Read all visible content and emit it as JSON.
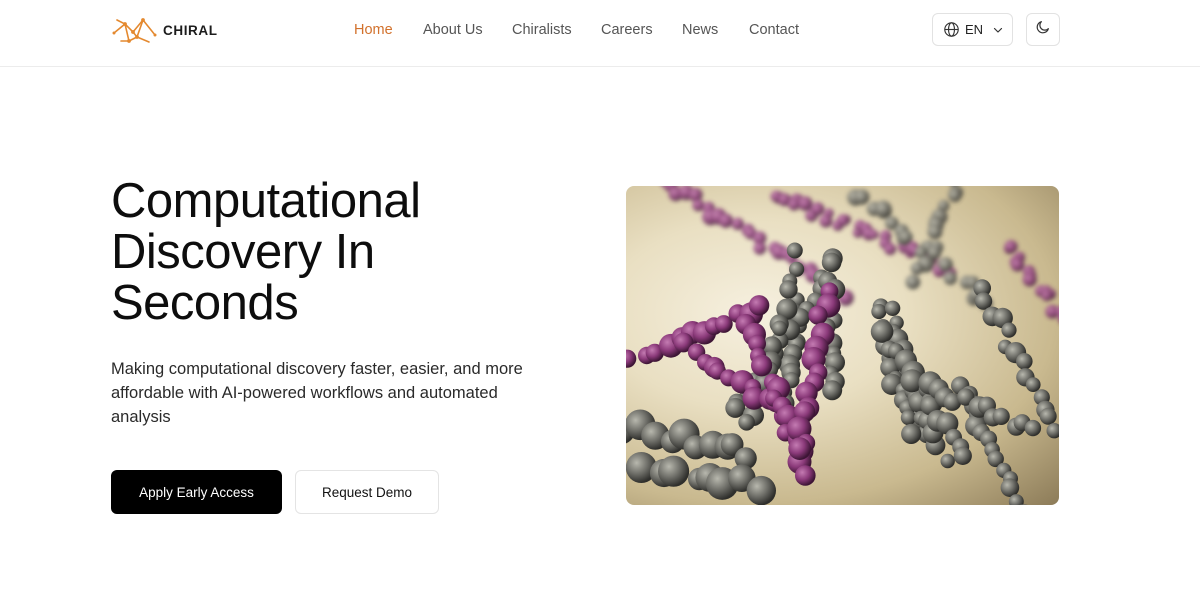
{
  "header": {
    "logo_text": "CHIRAL",
    "nav": [
      {
        "label": "Home",
        "active": true
      },
      {
        "label": "About Us",
        "active": false
      },
      {
        "label": "Chiralists",
        "active": false
      },
      {
        "label": "Careers",
        "active": false
      },
      {
        "label": "News",
        "active": false
      },
      {
        "label": "Contact",
        "active": false
      }
    ],
    "language": "EN",
    "icons": {
      "language": "globe-icon",
      "dropdown": "chevron-down-icon",
      "theme": "moon-icon"
    }
  },
  "hero": {
    "title_lines": [
      "Computational",
      "Discovery In",
      "Seconds"
    ],
    "subtitle": "Making computational discovery faster, easier, and more affordable with AI-powered workflows and automated analysis",
    "primary_button": "Apply Early Access",
    "secondary_button": "Request Demo",
    "image_subject": "molecular-structure-illustration"
  },
  "colors": {
    "accent": "#d2712c",
    "primary_button_bg": "#000000",
    "text": "#0d0d0d",
    "molecule_purple": "#8b3a7a",
    "molecule_grey": "#6e6e68"
  }
}
